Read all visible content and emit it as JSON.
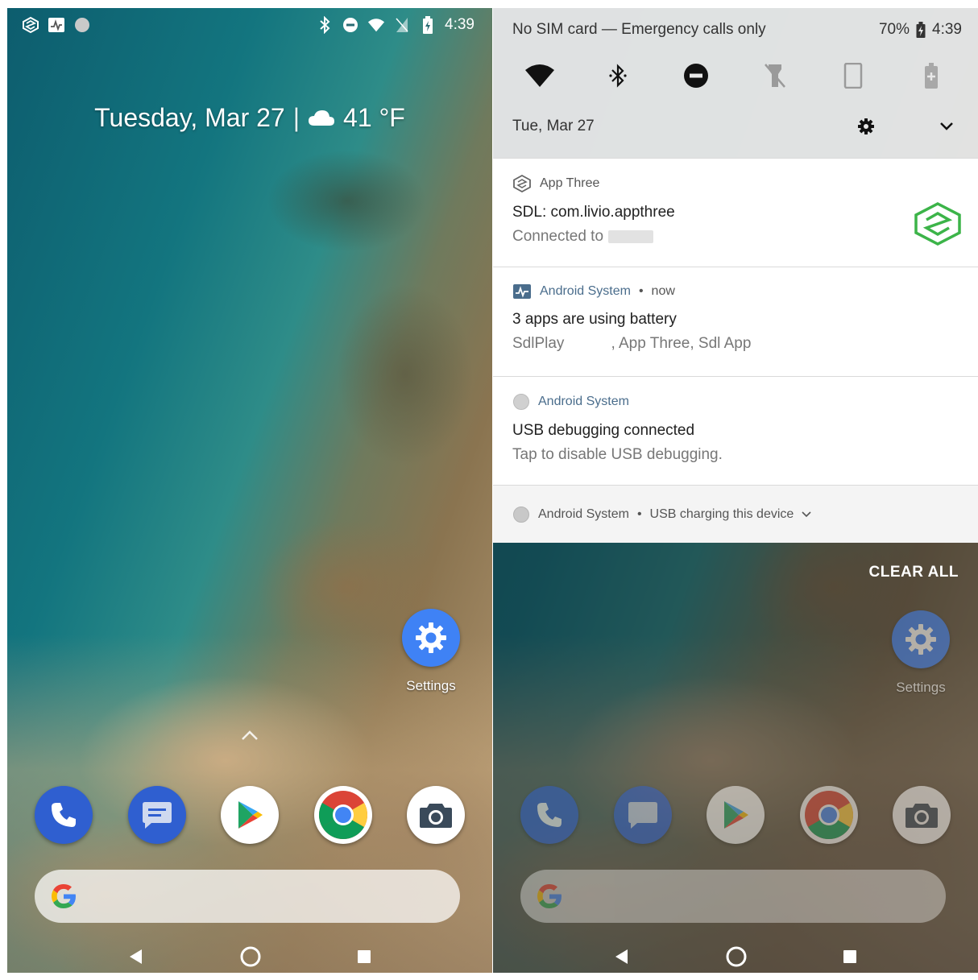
{
  "left": {
    "status": {
      "time": "4:39",
      "left_icons": [
        "sdl-app-icon",
        "activity-icon",
        "circle-dot-icon"
      ],
      "right_icons": [
        "bluetooth-icon",
        "dnd-icon",
        "wifi-icon",
        "no-sim-icon",
        "battery-charging-icon"
      ]
    },
    "glance": {
      "date": "Tuesday, Mar 27",
      "separator": "|",
      "weather": "41 °F"
    },
    "settings_shortcut": {
      "label": "Settings"
    },
    "dock": [
      "phone-icon",
      "messages-icon",
      "play-store-icon",
      "chrome-icon",
      "camera-icon"
    ],
    "search": {
      "logo": "google-g-icon"
    },
    "nav": [
      "back-icon",
      "home-icon",
      "recents-icon"
    ]
  },
  "right": {
    "header": {
      "carrier": "No SIM card — Emergency calls only",
      "battery": "70%",
      "time": "4:39"
    },
    "tiles": [
      "wifi-icon",
      "bluetooth-icon",
      "dnd-icon",
      "flashlight-off-icon",
      "rotation-icon",
      "battery-saver-icon"
    ],
    "footer": {
      "date": "Tue, Mar 27"
    },
    "notifications": [
      {
        "app": "App Three",
        "title": "SDL: com.livio.appthree",
        "text": "Connected to"
      },
      {
        "app": "Android System",
        "time": "now",
        "title": "3 apps are using battery",
        "text": "SdlPlay           , App Three, Sdl App"
      },
      {
        "app": "Android System",
        "title": "USB debugging connected",
        "text": "Tap to disable USB debugging."
      }
    ],
    "collapsed": {
      "app": "Android System",
      "text": "USB charging this device"
    },
    "bullet": "•",
    "clear_all": "CLEAR ALL",
    "settings_shortcut": {
      "label": "Settings"
    }
  },
  "colors": {
    "accent_blue": "#3f82f5",
    "sdl_green": "#3cb449",
    "shade_bg": "#e8e8e8"
  }
}
